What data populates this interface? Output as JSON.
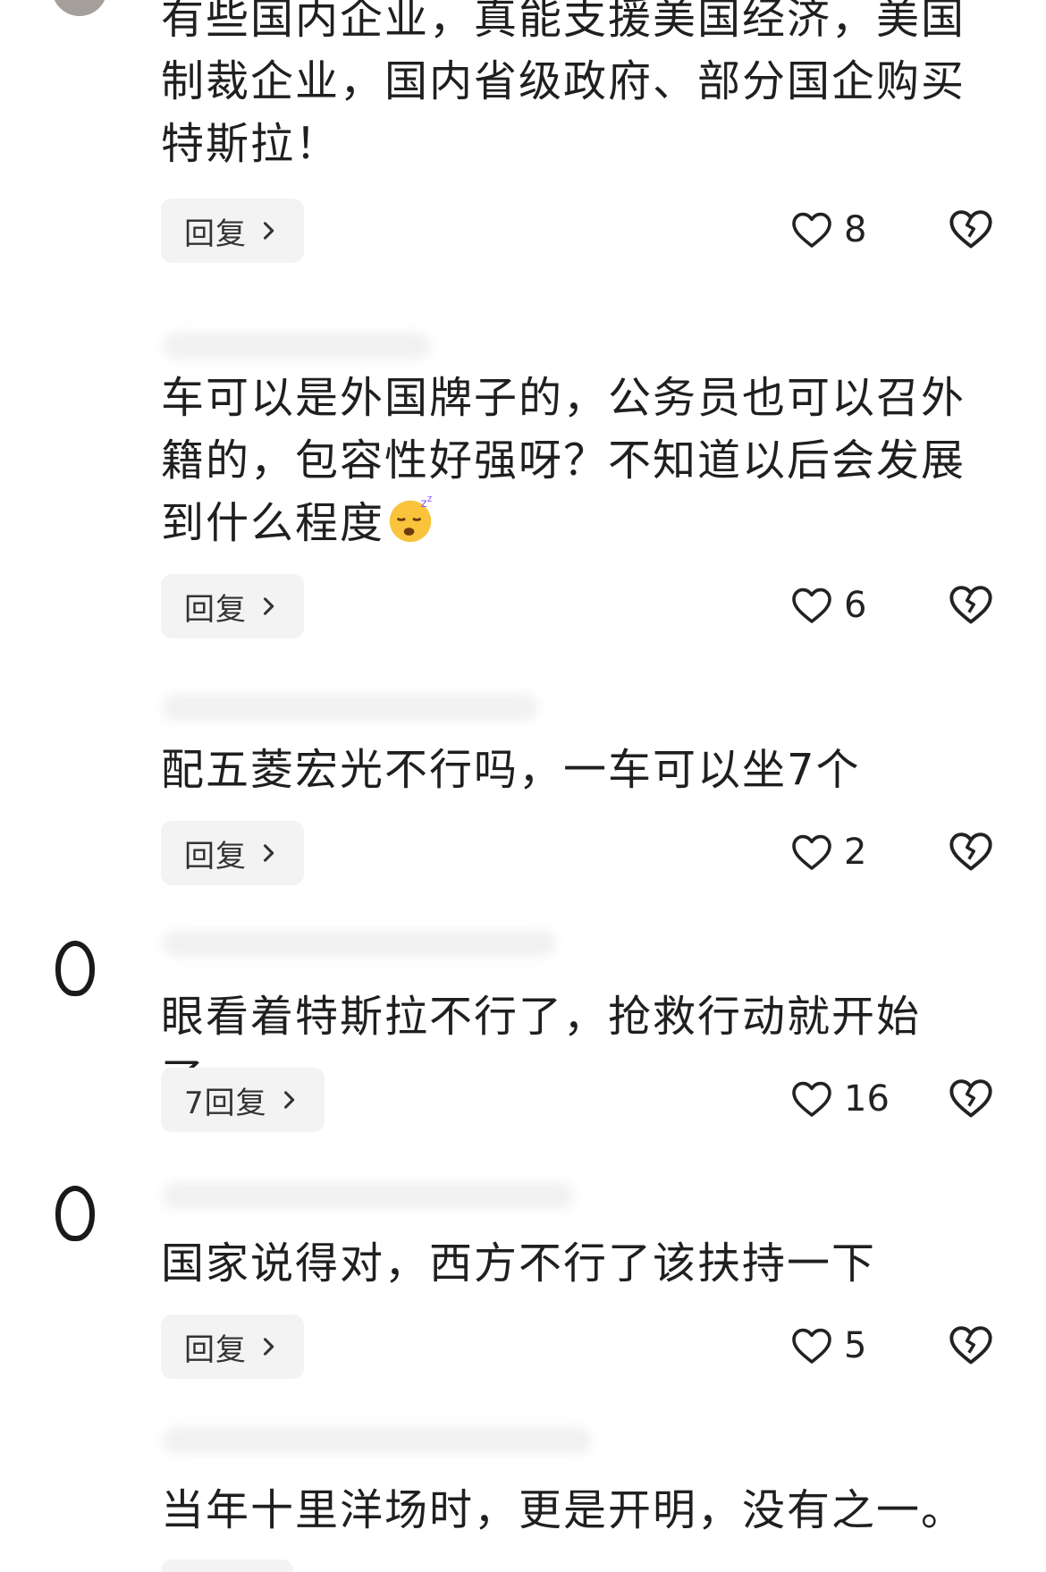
{
  "comments": [
    {
      "text": "有些国内企业，真能支援美国经济，美国制裁企业，国内省级政府、部分国企购买特斯拉！",
      "reply_label": "回复",
      "likes": "8"
    },
    {
      "text": "车可以是外国牌子的，公务员也可以召外籍的，包容性好强呀？不知道以后会发展到什么程度",
      "emoji_icon": "sleepy-face-icon",
      "reply_label": "回复",
      "likes": "6"
    },
    {
      "text": "配五菱宏光不行吗，一车可以坐7个",
      "reply_label": "回复",
      "likes": "2"
    },
    {
      "text": "眼看着特斯拉不行了，抢救行动就开始了。",
      "reply_label": "7回复",
      "likes": "16"
    },
    {
      "text": "国家说得对，西方不行了该扶持一下",
      "reply_label": "回复",
      "likes": "5"
    },
    {
      "text": "当年十里洋场时，更是开明，没有之一。"
    }
  ],
  "colors": {
    "reply_bg": "#f3f3f3",
    "text": "#1f1f1f",
    "background": "#ffffff"
  },
  "icons": {
    "like": "heart-outline-icon",
    "dislike": "broken-heart-outline-icon",
    "reply_arrow": "chevron-right-icon"
  }
}
